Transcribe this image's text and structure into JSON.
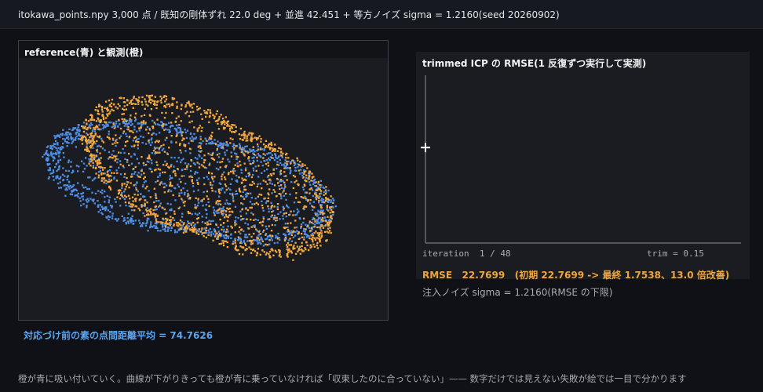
{
  "header": {
    "title": "itokawa_points.npy 3,000 点 / 既知の剛体ずれ 22.0 deg + 並進 42.451 + 等方ノイズ sigma = 1.2160(seed 20260902)"
  },
  "left_panel": {
    "title": "reference(青) と観測(橙)",
    "reference_color": "#4f8fe6",
    "observed_color": "#f5a93e"
  },
  "distance_text": "対応づけ前の素の点間距離平均 = 74.7626",
  "right_panel": {
    "title": "trimmed ICP の RMSE(1 反復ずつ実行して実測)",
    "iteration_text": "iteration  1 / 48",
    "trim_text": "trim = 0.15",
    "rmse_text": "RMSE   22.7699   (初期 22.7699 -> 最終 1.7538、13.0 倍改善)",
    "noise_text": "注入ノイズ sigma = 1.2160(RMSE の下限)"
  },
  "footer_text": "橙が青に吸い付いていく。曲線が下がりきっても橙が青に乗っていなければ「収束したのに合っていない」—— 数字だけでは見えない失敗が絵では一目で分かります",
  "chart_data": {
    "type": "line",
    "title": "trimmed ICP の RMSE(1 反復ずつ実行して実測)",
    "xlabel": "iteration",
    "ylabel": "",
    "xlim": [
      1,
      48
    ],
    "points": [
      {
        "iteration": 1,
        "rmse": 22.7699
      }
    ],
    "series": [
      {
        "values": [
          22.7699
        ]
      }
    ],
    "grid": false
  }
}
